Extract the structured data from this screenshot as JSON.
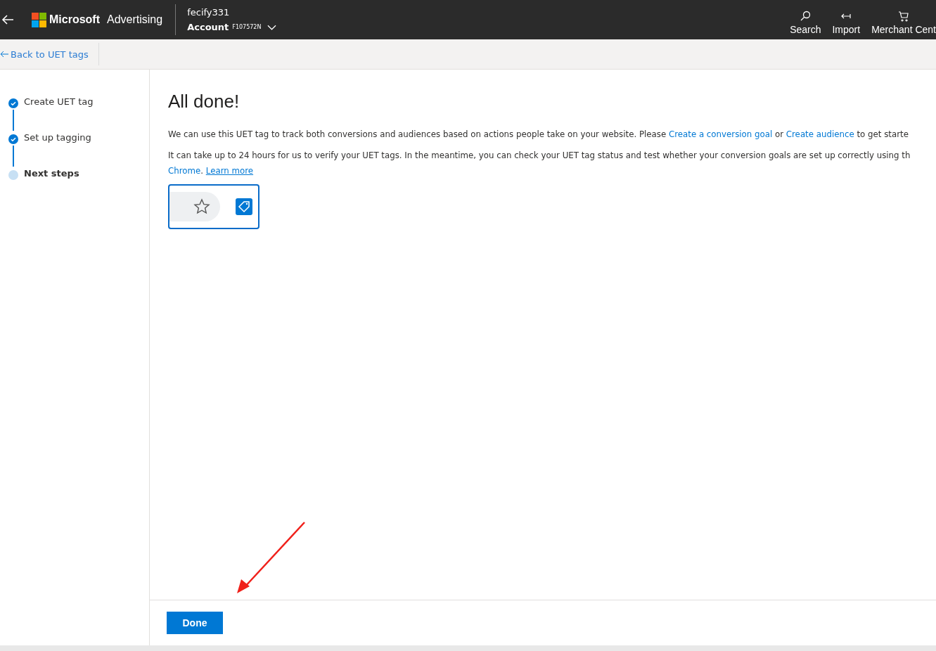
{
  "header": {
    "brand": "Microsoft",
    "product": "Advertising",
    "user": "fecify331",
    "account_label": "Account",
    "account_id": "F107572N",
    "actions": [
      {
        "kind": "search",
        "label": "Search"
      },
      {
        "kind": "import",
        "label": "Import"
      },
      {
        "kind": "cart",
        "label": "Merchant Cent"
      }
    ]
  },
  "back_link": "Back to UET tags",
  "steps": [
    {
      "label": "Create UET tag",
      "completed": true,
      "selected": false
    },
    {
      "label": "Set up tagging",
      "completed": true,
      "selected": false
    },
    {
      "label": "Next steps",
      "completed": false,
      "selected": true
    }
  ],
  "title": "All done!",
  "paragraphs": [
    [
      {
        "kind": "text",
        "text": "We can use this UET tag to track both conversions and audiences based on actions people take on your website. Please "
      },
      {
        "kind": "link",
        "text": "Create a conversion goal"
      },
      {
        "kind": "text",
        "text": " or "
      },
      {
        "kind": "link",
        "text": "Create audience"
      },
      {
        "kind": "text",
        "text": " to get starte"
      }
    ],
    [
      {
        "kind": "text",
        "text": "It can take up to 24 hours for us to verify your UET tags. In the meantime, you can check your UET tag status and test whether your conversion goals are set up correctly using th "
      },
      {
        "kind": "link",
        "text": "Chrome"
      },
      {
        "kind": "text",
        "text": ".  "
      },
      {
        "kind": "ulink",
        "text": "Learn more"
      }
    ]
  ],
  "done_button": "Done"
}
